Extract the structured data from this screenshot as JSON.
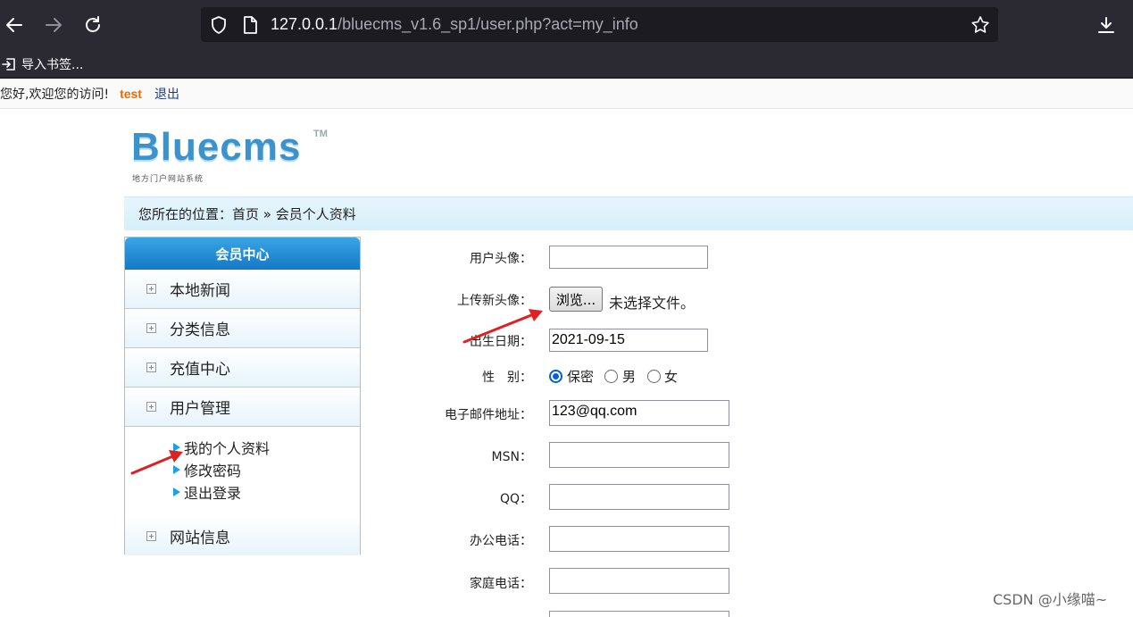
{
  "browser": {
    "url_host": "127.0.0.1",
    "url_path": "/bluecms_v1.6_sp1/user.php?act=my_info",
    "bookmark_label": "导入书签..."
  },
  "welcome": {
    "greeting": "您好,欢迎您的访问!",
    "username": "test",
    "logout": "退出"
  },
  "logo": {
    "name": "Bluecms",
    "tm": "TM",
    "tagline": "地方门户网站系统"
  },
  "breadcrumb": "您所在的位置：首页 » 会员个人资料",
  "sidebar": {
    "title": "会员中心",
    "items": [
      "本地新闻",
      "分类信息",
      "充值中心",
      "用户管理"
    ],
    "sub_items": [
      "我的个人资料",
      "修改密码",
      "退出登录"
    ],
    "last_item": "网站信息"
  },
  "form": {
    "avatar_label": "用户头像：",
    "upload_label": "上传新头像：",
    "browse_button": "浏览...",
    "no_file": "未选择文件。",
    "birthday_label": "出生日期：",
    "birthday_value": "2021-09-15",
    "gender_label": "性　别：",
    "gender_options": [
      "保密",
      "男",
      "女"
    ],
    "email_label": "电子邮件地址：",
    "email_value": "123@qq.com",
    "msn_label": "MSN：",
    "qq_label": "QQ：",
    "office_phone_label": "办公电话：",
    "home_phone_label": "家庭电话："
  },
  "watermark": "CSDN @小缘喵~",
  "colors": {
    "chrome_bg": "#2b2a33",
    "accent_blue": "#1378c6",
    "username_orange": "#f06b00",
    "annotation_red": "#e02020"
  }
}
